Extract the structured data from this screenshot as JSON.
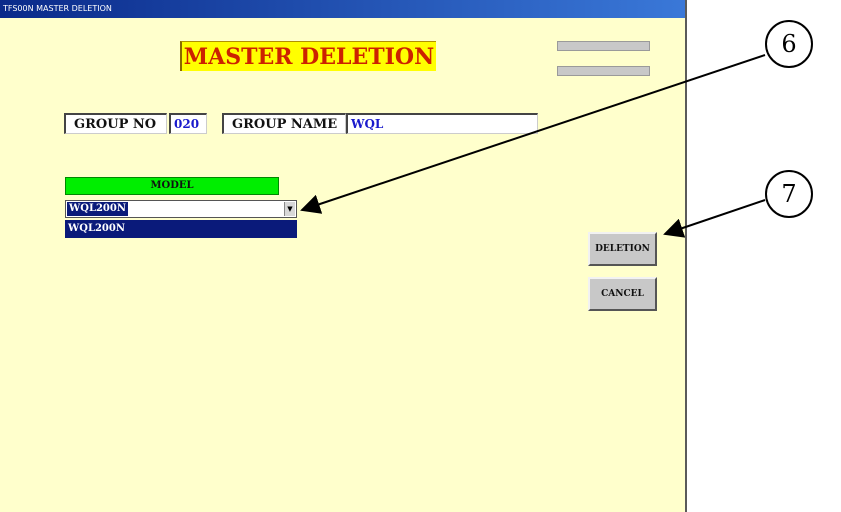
{
  "window": {
    "title": "TFS00N MASTER DELETION",
    "heading": "MASTER DELETION"
  },
  "group": {
    "no_label": "GROUP NO",
    "no_value": "020",
    "name_label": "GROUP NAME",
    "name_value": "WQL"
  },
  "model": {
    "header": "MODEL",
    "selected": "WQL200N",
    "list_items": [
      "WQL200N"
    ]
  },
  "buttons": {
    "deletion": "DELETION",
    "cancel": "CANCEL"
  },
  "callouts": {
    "dropdown_marker": "6",
    "deletion_marker": "7"
  }
}
